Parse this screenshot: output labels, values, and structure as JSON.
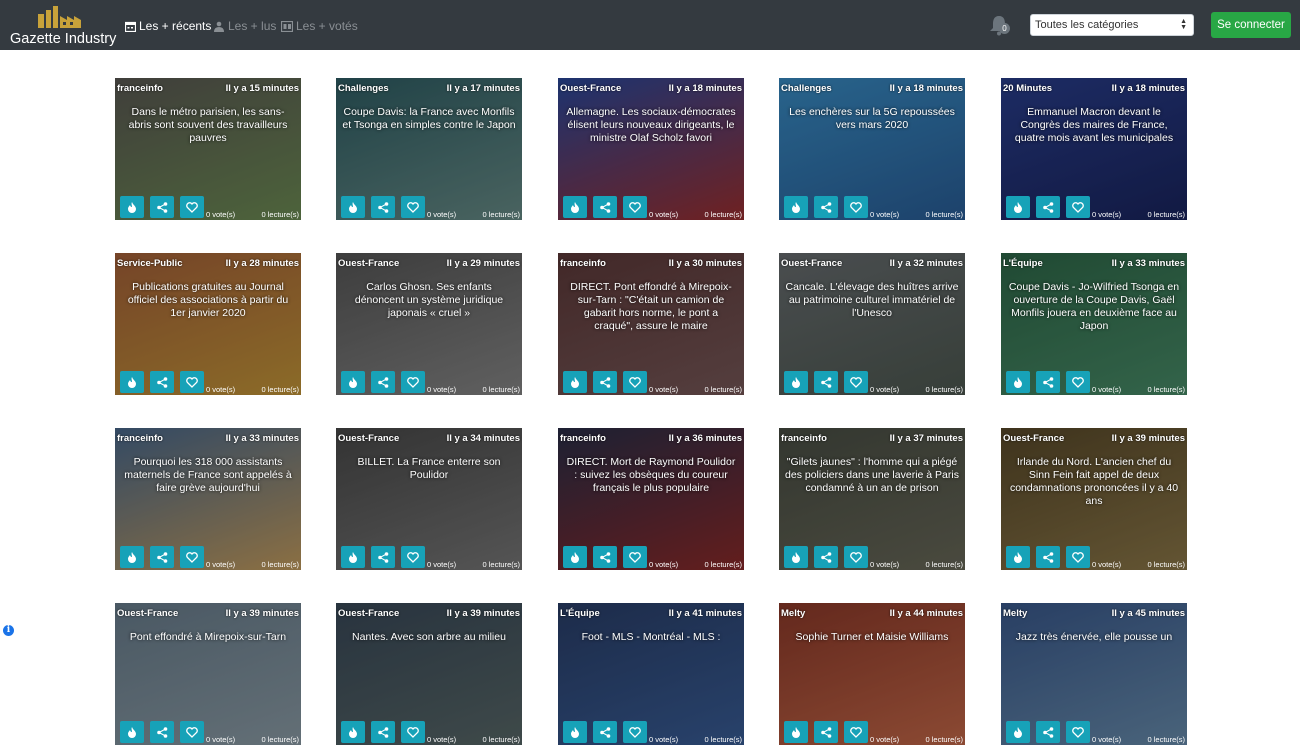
{
  "brand": {
    "name": "Gazette Industry",
    "logo_icon": "factory-icon"
  },
  "nav": [
    {
      "label": "Les + récents",
      "icon": "calendar-icon",
      "active": true
    },
    {
      "label": "Les + lus",
      "icon": "readers-icon",
      "active": false
    },
    {
      "label": "Les + votés",
      "icon": "ballot-icon",
      "active": false
    }
  ],
  "notifications": {
    "count": "0",
    "icon": "bell-icon"
  },
  "category_select": {
    "selected": "Toutes les catégories"
  },
  "login_label": "Se connecter",
  "colors": {
    "navbar": "#343a40",
    "action_button": "#17a2b8",
    "login": "#28a745"
  },
  "card_labels": {
    "votes": "0 vote(s)",
    "reads": "0 lecture(s)"
  },
  "cards": [
    {
      "source": "franceinfo",
      "time": "Il y a 15 minutes",
      "title": "Dans le métro parisien, les sans-abris sont souvent des travailleurs pauvres",
      "bg": [
        "#5c5a55",
        "#6f8f55"
      ]
    },
    {
      "source": "Challenges",
      "time": "Il y a 17 minutes",
      "title": "Coupe Davis: la France avec Monfils et Tsonga en simples contre le Japon",
      "bg": [
        "#2f5f66",
        "#6a8f8a"
      ]
    },
    {
      "source": "Ouest-France",
      "time": "Il y a 18 minutes",
      "title": "Allemagne. Les sociaux-démocrates élisent leurs nouveaux dirigeants, le ministre Olaf Scholz favori",
      "bg": [
        "#2a4aa0",
        "#a03030"
      ]
    },
    {
      "source": "Challenges",
      "time": "Il y a 18 minutes",
      "title": "Les enchères sur la 5G repoussées vers mars 2020",
      "bg": [
        "#3a8fc8",
        "#2a5f9a"
      ]
    },
    {
      "source": "20 Minutes",
      "time": "Il y a 18 minutes",
      "title": "Emmanuel Macron devant le Congrès des maires de France, quatre mois avant les municipales",
      "bg": [
        "#2a3f8f",
        "#1a2560"
      ]
    },
    {
      "source": "Service-Public",
      "time": "Il y a 28 minutes",
      "title": "Publications gratuites au Journal officiel des associations à partir du 1er janvier 2020",
      "bg": [
        "#a8623a",
        "#c89a3a"
      ]
    },
    {
      "source": "Ouest-France",
      "time": "Il y a 29 minutes",
      "title": "Carlos Ghosn. Ses enfants dénoncent un système juridique japonais « cruel »",
      "bg": [
        "#585858",
        "#8a8a8a"
      ]
    },
    {
      "source": "franceinfo",
      "time": "Il y a 30 minutes",
      "title": "DIRECT. Pont effondré à Mirepoix-sur-Tarn : \"C'était un camion de gabarit hors norme, le pont a craqué\", assure le maire",
      "bg": [
        "#5f3a3a",
        "#7a5a5a"
      ]
    },
    {
      "source": "Ouest-France",
      "time": "Il y a 32 minutes",
      "title": "Cancale. L'élevage des huîtres arrive au patrimoine culturel immatériel de l'Unesco",
      "bg": [
        "#6a6f72",
        "#4f5a52"
      ]
    },
    {
      "source": "L'Équipe",
      "time": "Il y a 33 minutes",
      "title": "Coupe Davis - Jo-Wilfried Tsonga en ouverture de la Coupe Davis, Gaël Monfils jouera en deuxième face au Japon",
      "bg": [
        "#2f6a4a",
        "#4a8f6a"
      ]
    },
    {
      "source": "franceinfo",
      "time": "Il y a 33 minutes",
      "title": "Pourquoi les 318 000 assistants maternels de France sont appelés à faire grève aujourd'hui",
      "bg": [
        "#4a6a8f",
        "#c8a060"
      ]
    },
    {
      "source": "Ouest-France",
      "time": "Il y a 34 minutes",
      "title": "BILLET. La France enterre son Poulidor",
      "bg": [
        "#4a4a4a",
        "#7a7a7a"
      ]
    },
    {
      "source": "franceinfo",
      "time": "Il y a 36 minutes",
      "title": "DIRECT. Mort de Raymond Poulidor : suivez les obsèques du coureur français le plus populaire",
      "bg": [
        "#2a2f4a",
        "#8f2a2a"
      ]
    },
    {
      "source": "franceinfo",
      "time": "Il y a 37 minutes",
      "title": "\"Gilets jaunes\" : l'homme qui a piégé des policiers dans une laverie à Paris condamné à un an de prison",
      "bg": [
        "#4a4f45",
        "#6a6a5a"
      ]
    },
    {
      "source": "Ouest-France",
      "time": "Il y a 39 minutes",
      "title": "Irlande du Nord. L'ancien chef du Sinn Fein fait appel de deux condamnations prononcées il y a 40 ans",
      "bg": [
        "#5a4a2a",
        "#8f7a4a"
      ]
    },
    {
      "source": "Ouest-France",
      "time": "Il y a 39 minutes",
      "title": "Pont effondré à Mirepoix-sur-Tarn",
      "bg": [
        "#6a7f8f",
        "#8fa0aa"
      ]
    },
    {
      "source": "Ouest-France",
      "time": "Il y a 39 minutes",
      "title": "Nantes. Avec son arbre au milieu",
      "bg": [
        "#3a4a5a",
        "#5a6a6a"
      ]
    },
    {
      "source": "L'Équipe",
      "time": "Il y a 41 minutes",
      "title": "Foot - MLS - Montréal - MLS :",
      "bg": [
        "#2a3f6a",
        "#3a5f9a"
      ]
    },
    {
      "source": "Melty",
      "time": "Il y a 44 minutes",
      "title": "Sophie Turner et Maisie Williams",
      "bg": [
        "#8f3a2a",
        "#c86a4a"
      ]
    },
    {
      "source": "Melty",
      "time": "Il y a 45 minutes",
      "title": "Jazz très énervée, elle pousse un",
      "bg": [
        "#3a5a8f",
        "#6a8fb0"
      ]
    }
  ]
}
